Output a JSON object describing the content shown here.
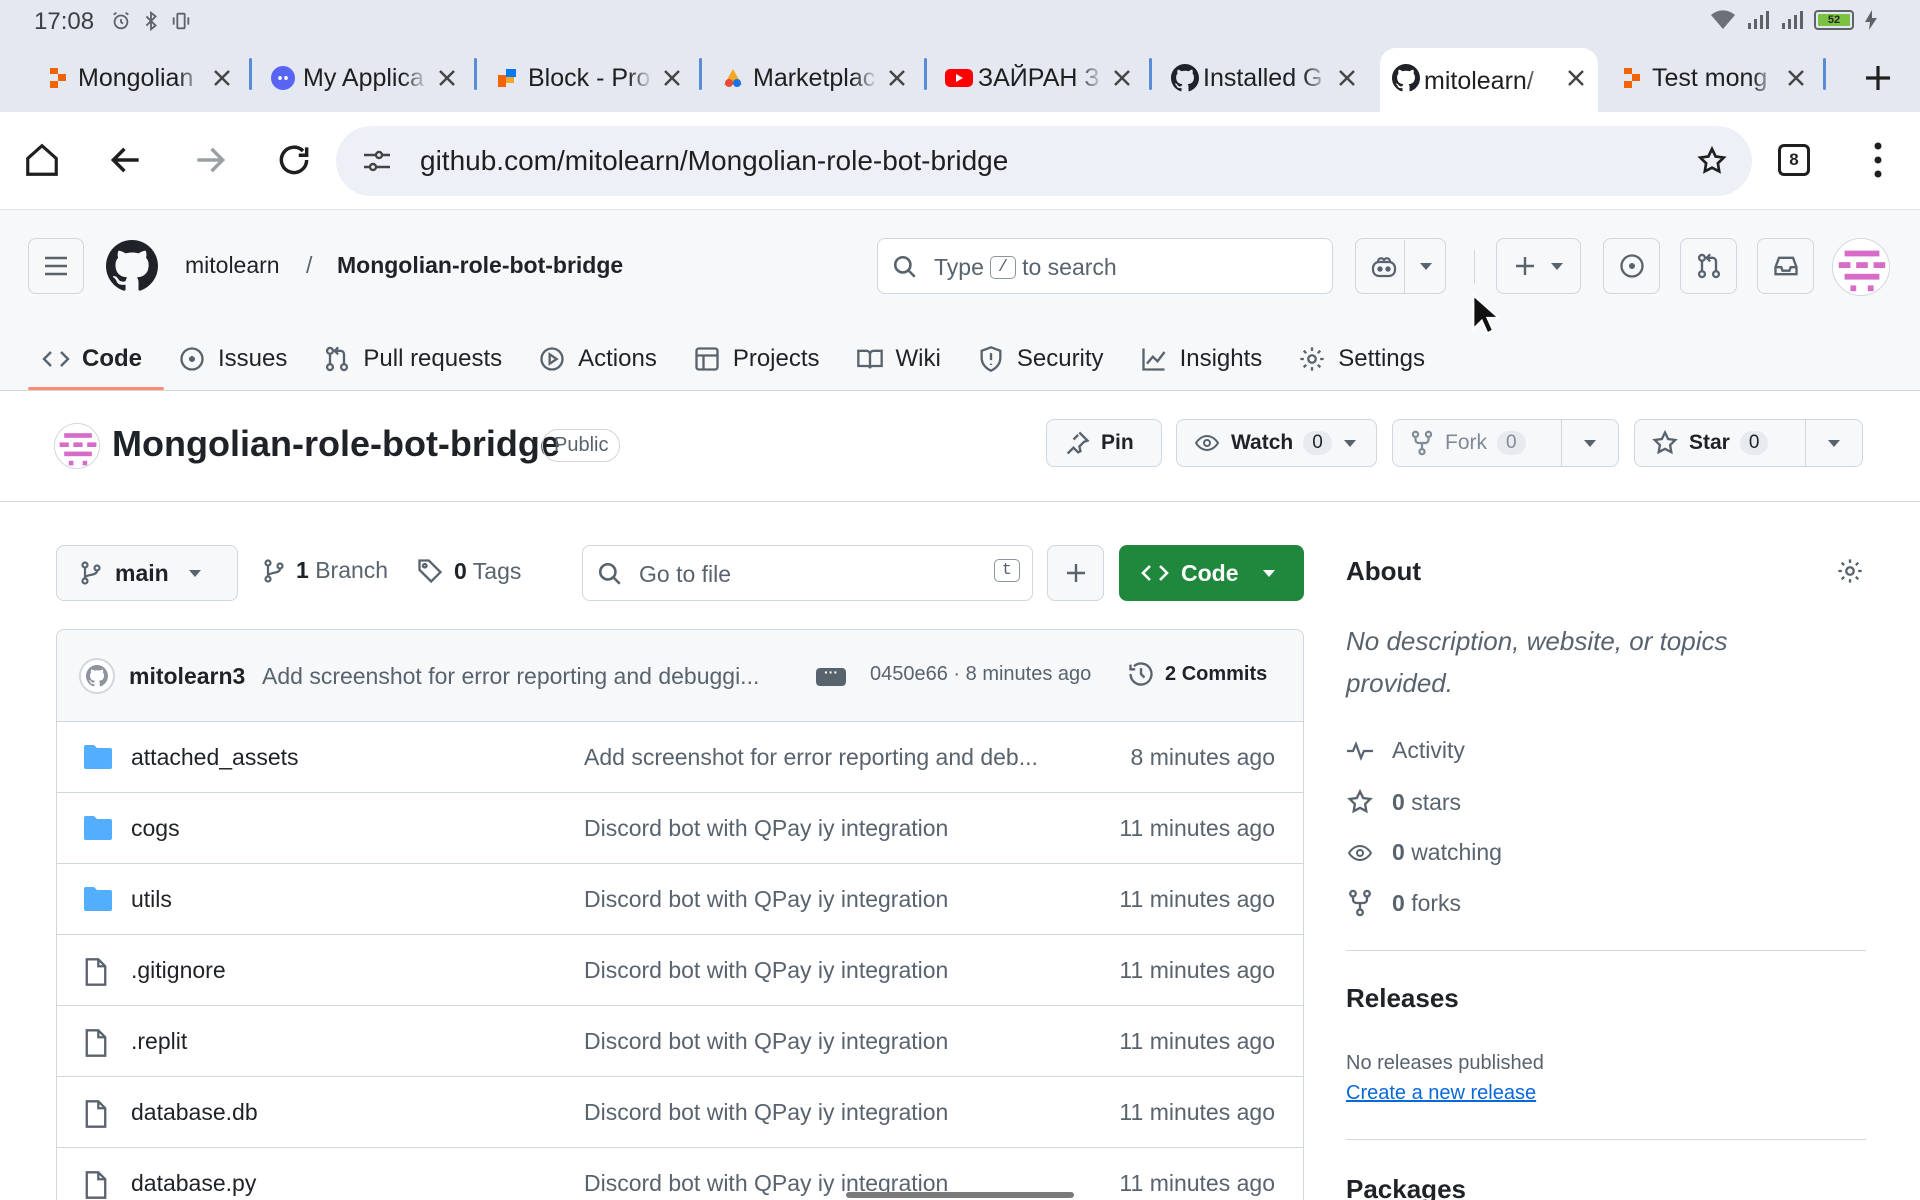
{
  "status_bar": {
    "time": "17:08",
    "battery_level": "52",
    "icons": [
      "alarm-icon",
      "bluetooth-icon",
      "vibrate-icon",
      "wifi-icon",
      "signal-icon",
      "signal-icon",
      "battery-icon",
      "charging-icon"
    ]
  },
  "tabs": [
    {
      "label": "Mongolian",
      "favicon": "replit",
      "active": false
    },
    {
      "label": "My Applica",
      "favicon": "discord",
      "active": false
    },
    {
      "label": "Block - Pro",
      "favicon": "block",
      "active": false
    },
    {
      "label": "Marketplac",
      "favicon": "marketplace",
      "active": false
    },
    {
      "label": "ЗАЙРАН З",
      "favicon": "youtube",
      "active": false
    },
    {
      "label": "Installed G",
      "favicon": "github",
      "active": false
    },
    {
      "label": "mitolearn/",
      "favicon": "github",
      "active": true
    },
    {
      "label": "Test mong",
      "favicon": "replit",
      "active": false
    }
  ],
  "toolbar": {
    "url": "github.com/mitolearn/Mongolian-role-bot-bridge",
    "tab_count": "8"
  },
  "header": {
    "owner": "mitolearn",
    "separator": "/",
    "repo": "Mongolian-role-bot-bridge",
    "search_prefix": "Type",
    "search_key": "/",
    "search_suffix": "to search"
  },
  "repo_nav": [
    {
      "label": "Code",
      "icon": "code-icon",
      "selected": true
    },
    {
      "label": "Issues",
      "icon": "issue-icon",
      "selected": false
    },
    {
      "label": "Pull requests",
      "icon": "pull-request-icon",
      "selected": false
    },
    {
      "label": "Actions",
      "icon": "play-icon",
      "selected": false
    },
    {
      "label": "Projects",
      "icon": "table-icon",
      "selected": false
    },
    {
      "label": "Wiki",
      "icon": "book-icon",
      "selected": false
    },
    {
      "label": "Security",
      "icon": "shield-icon",
      "selected": false
    },
    {
      "label": "Insights",
      "icon": "graph-icon",
      "selected": false
    },
    {
      "label": "Settings",
      "icon": "gear-icon",
      "selected": false
    }
  ],
  "repo": {
    "title": "Mongolian-role-bot-bridge",
    "visibility": "Public",
    "pin_label": "Pin",
    "watch_label": "Watch",
    "watch_count": "0",
    "fork_label": "Fork",
    "fork_count": "0",
    "star_label": "Star",
    "star_count": "0"
  },
  "files_toolbar": {
    "branch": "main",
    "branch_count": "1",
    "branch_label": "Branch",
    "tag_count": "0",
    "tag_label": "Tags",
    "goto_placeholder": "Go to file",
    "goto_key": "t",
    "code_label": "Code"
  },
  "latest_commit": {
    "author": "mitolearn3",
    "message": "Add screenshot for error reporting and debuggi...",
    "sha_time": "0450e66 · 8 minutes ago",
    "commits_count": "2",
    "commits_label": "Commits"
  },
  "files": [
    {
      "type": "dir",
      "name": "attached_assets",
      "message": "Add screenshot for error reporting and deb...",
      "time": "8 minutes ago"
    },
    {
      "type": "dir",
      "name": "cogs",
      "message": "Discord bot with QPay iy integration",
      "time": "11 minutes ago"
    },
    {
      "type": "dir",
      "name": "utils",
      "message": "Discord bot with QPay iy integration",
      "time": "11 minutes ago"
    },
    {
      "type": "file",
      "name": ".gitignore",
      "message": "Discord bot with QPay iy integration",
      "time": "11 minutes ago"
    },
    {
      "type": "file",
      "name": ".replit",
      "message": "Discord bot with QPay iy integration",
      "time": "11 minutes ago"
    },
    {
      "type": "file",
      "name": "database.db",
      "message": "Discord bot with QPay iy integration",
      "time": "11 minutes ago"
    },
    {
      "type": "file",
      "name": "database.py",
      "message": "Discord bot with QPay iy integration",
      "time": "11 minutes ago"
    }
  ],
  "about": {
    "title": "About",
    "description": "No description, website, or topics provided.",
    "activity": "Activity",
    "stars_count": "0",
    "stars_label": "stars",
    "watching_count": "0",
    "watching_label": "watching",
    "forks_count": "0",
    "forks_label": "forks"
  },
  "releases": {
    "title": "Releases",
    "none": "No releases published",
    "create_link": "Create a new release"
  },
  "packages": {
    "title": "Packages"
  },
  "colors": {
    "accent_green": "#1f883d",
    "nav_underline": "#fd8c73",
    "link_blue": "#0969da",
    "folder_blue": "#54aeff"
  }
}
